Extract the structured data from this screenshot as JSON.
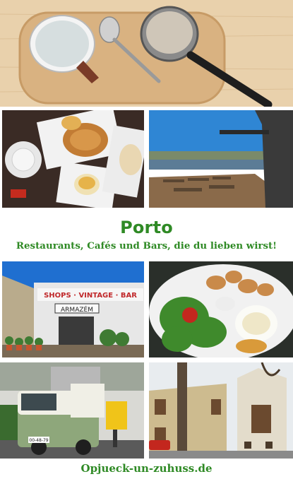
{
  "title": "Porto",
  "subtitle": "Restaurants, Cafés und Bars, die du lieben wirst!",
  "footer": "Opjueck-un-zuhuss.de",
  "signs": {
    "shop_sign": "SHOPS · VINTAGE · BAR",
    "shop_name": "ARMAZÉM",
    "van_plate": "00-48-79"
  },
  "colors": {
    "accent_green": "#2f8a25",
    "background": "#ffffff"
  },
  "photos": [
    {
      "name": "coffee-cup-and-pot-photo"
    },
    {
      "name": "pastries-photo"
    },
    {
      "name": "river-terrace-photo"
    },
    {
      "name": "vintage-bar-shop-photo"
    },
    {
      "name": "salad-plate-photo"
    },
    {
      "name": "vintage-van-photo"
    },
    {
      "name": "chapel-photo"
    }
  ]
}
